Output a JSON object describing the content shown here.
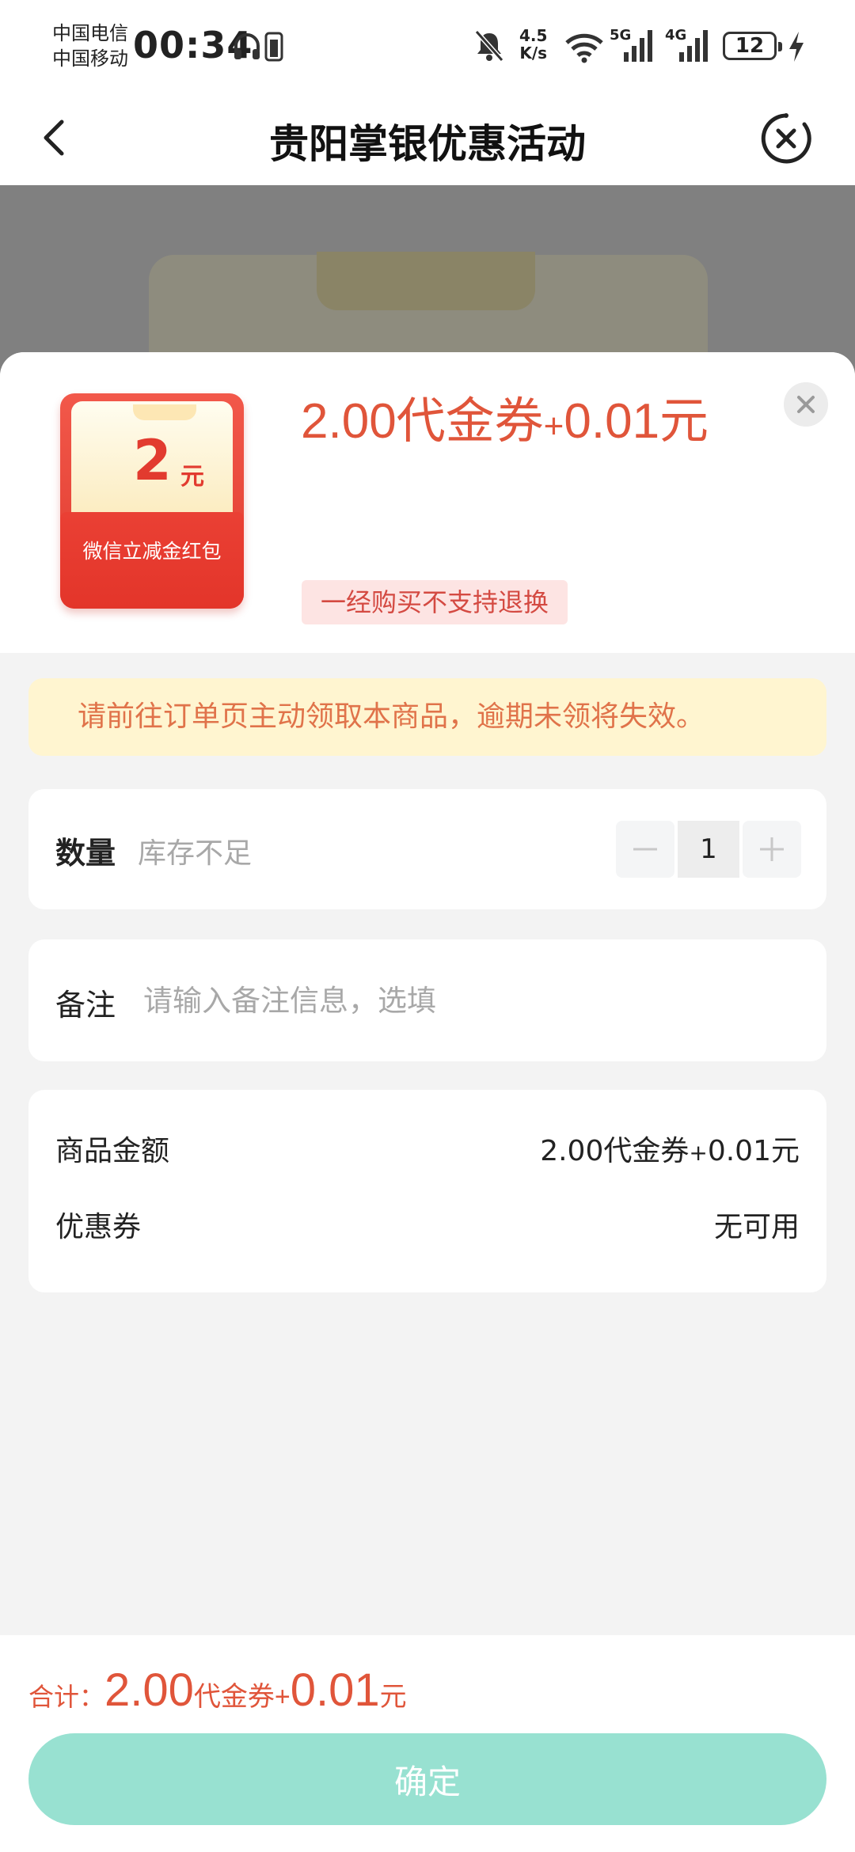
{
  "status_bar": {
    "carrier1": "中国电信",
    "carrier2": "中国移动",
    "time": "00:34",
    "net_speed_value": "4.5",
    "net_speed_unit": "K/s",
    "signal1_label": "5G",
    "signal2_label": "4G",
    "battery": "12"
  },
  "nav": {
    "title": "贵阳掌银优惠活动"
  },
  "product": {
    "image_amount": "2",
    "image_unit": "元",
    "image_label": "微信立减金红包",
    "price_main": "2.00代金券",
    "price_plus": "+",
    "price_cash": "0.01元",
    "no_refund_tag": "一经购买不支持退换"
  },
  "notice": "请前往订单页主动领取本商品，逾期未领将失效。",
  "quantity": {
    "label": "数量",
    "hint": "库存不足",
    "value": "1"
  },
  "remark": {
    "label": "备注",
    "placeholder": "请输入备注信息，选填"
  },
  "summary": {
    "amount_label": "商品金额",
    "amount_value_main": "2.00代金券",
    "amount_value_plus": "+",
    "amount_value_cash": "0.01元",
    "coupon_label": "优惠券",
    "coupon_value": "无可用"
  },
  "footer": {
    "total_label": "合计：",
    "total_amount": "2.00",
    "total_coupon_unit": "代金券",
    "total_plus": "+",
    "total_cash": "0.01",
    "total_cash_unit": "元",
    "confirm_label": "确定"
  },
  "colors": {
    "accent": "#e0553a",
    "confirm_button": "#98e1d1",
    "notice_bg": "#fff5d0",
    "tag_bg": "#fde4e3"
  }
}
